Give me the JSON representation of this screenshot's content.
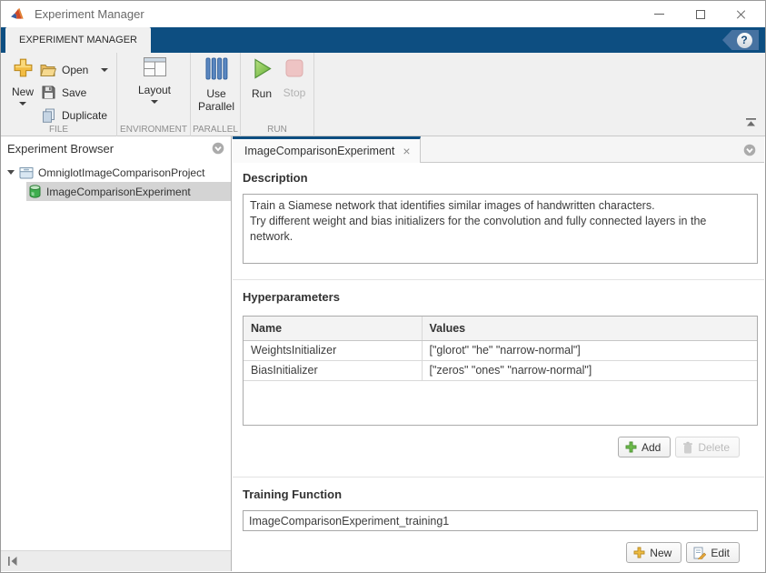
{
  "window": {
    "title": "Experiment Manager"
  },
  "ribbon": {
    "tab_label": "EXPERIMENT MANAGER",
    "help_glyph": "?"
  },
  "toolbar": {
    "file": {
      "section_label": "FILE",
      "new_label": "New",
      "open_label": "Open",
      "save_label": "Save",
      "duplicate_label": "Duplicate"
    },
    "environment": {
      "section_label": "ENVIRONMENT",
      "layout_label": "Layout"
    },
    "parallel": {
      "section_label": "PARALLEL",
      "use_parallel_line1": "Use",
      "use_parallel_line2": "Parallel"
    },
    "run": {
      "section_label": "RUN",
      "run_label": "Run",
      "stop_label": "Stop"
    }
  },
  "browser": {
    "title": "Experiment Browser",
    "project_label": "OmniglotImageComparisonProject",
    "experiment_label": "ImageComparisonExperiment"
  },
  "document": {
    "tab_label": "ImageComparisonExperiment",
    "close_glyph": "×",
    "description": {
      "heading": "Description",
      "text": "Train a Siamese network that identifies similar images of handwritten characters.\nTry different weight and bias initializers for the convolution and fully connected layers in the network."
    },
    "hyperparameters": {
      "heading": "Hyperparameters",
      "columns": [
        "Name",
        "Values"
      ],
      "rows": [
        [
          "WeightsInitializer",
          "[\"glorot\" \"he\" \"narrow-normal\"]"
        ],
        [
          "BiasInitializer",
          "[\"zeros\" \"ones\" \"narrow-normal\"]"
        ]
      ],
      "add_label": "Add",
      "delete_label": "Delete"
    },
    "training": {
      "heading": "Training Function",
      "function_name": "ImageComparisonExperiment_training1",
      "new_label": "New",
      "edit_label": "Edit"
    }
  },
  "colors": {
    "accent_blue": "#0d4e81",
    "selection_gray": "#d4d4d4",
    "run_green": "#76b94a",
    "stop_pink": "#eec4c4"
  }
}
